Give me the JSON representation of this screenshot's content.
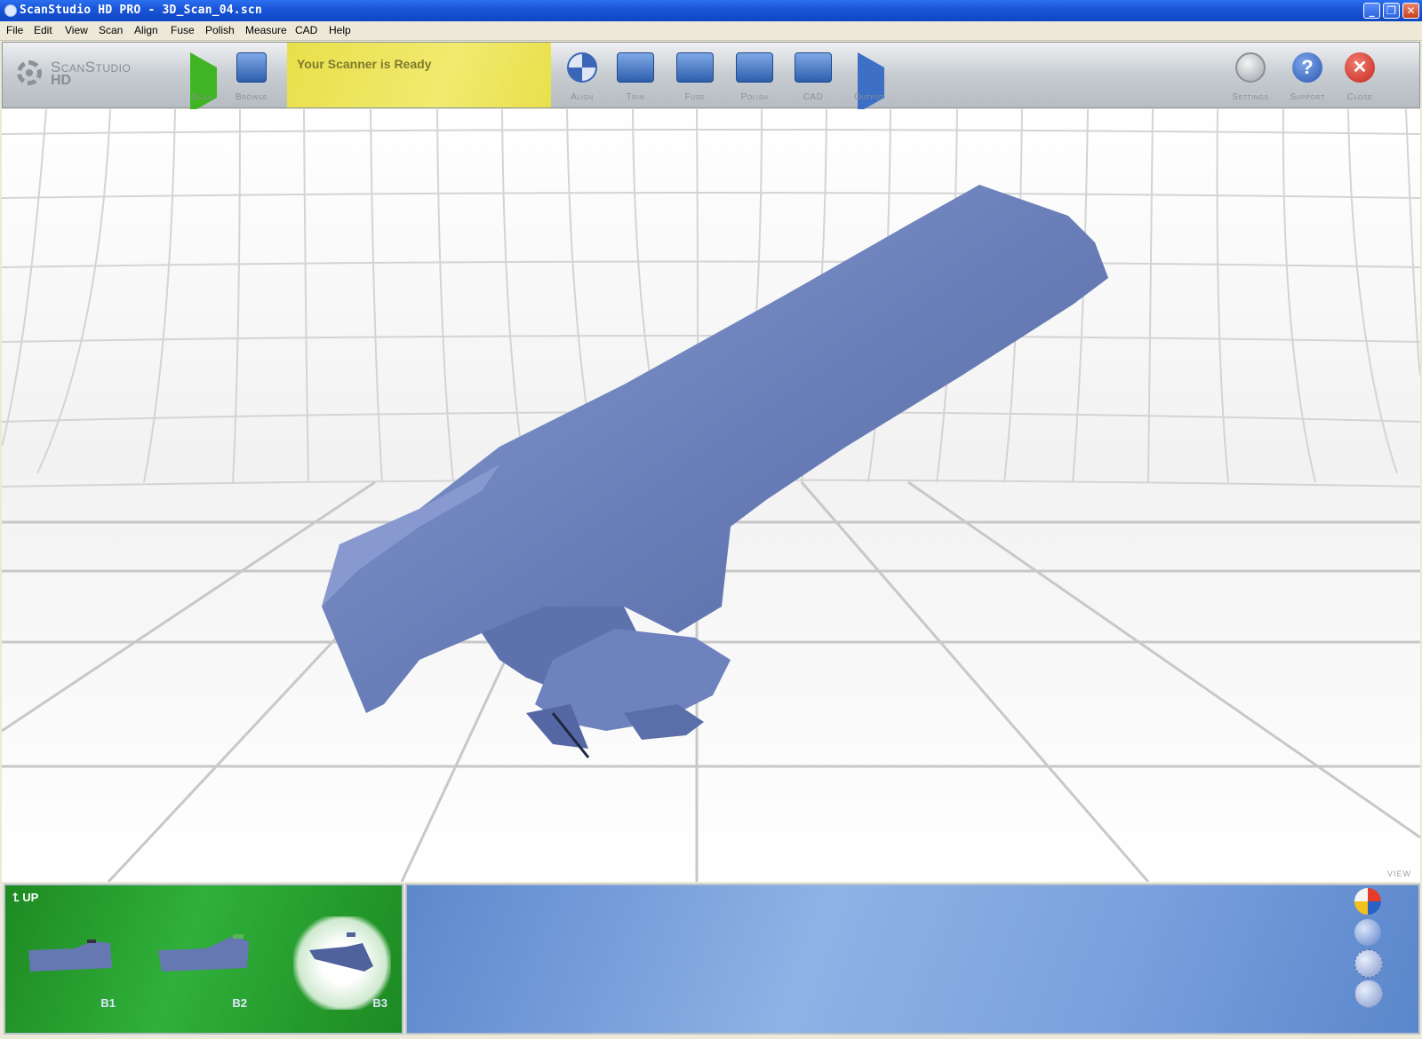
{
  "window": {
    "title": "ScanStudio HD PRO - 3D_Scan_04.scn"
  },
  "menu": [
    "File",
    "Edit",
    "View",
    "Scan",
    "Align",
    "Fuse",
    "Polish",
    "Measure",
    "CAD",
    "Help"
  ],
  "logo": {
    "line1": "ScanStudio",
    "line2": "HD"
  },
  "toolbar": {
    "scan": "Scan",
    "browse": "Browse",
    "status": "Your Scanner is Ready",
    "align": "Align",
    "trim": "Trim",
    "fuse": "Fuse",
    "polish": "Polish",
    "cad": "CAD",
    "output": "Output",
    "settings": "Settings",
    "support": "Support",
    "close": "Close"
  },
  "viewport": {
    "label": "VIEW",
    "model_color": "#6a7fb9"
  },
  "thumbnails": {
    "up": "UP",
    "items": [
      {
        "label": "B1",
        "selected": false
      },
      {
        "label": "B2",
        "selected": false
      },
      {
        "label": "B3",
        "selected": true
      }
    ]
  },
  "icons": {
    "view_balls": [
      "color-sphere-icon",
      "shaded-sphere-icon",
      "wireframe-sphere-icon",
      "points-sphere-icon"
    ]
  }
}
